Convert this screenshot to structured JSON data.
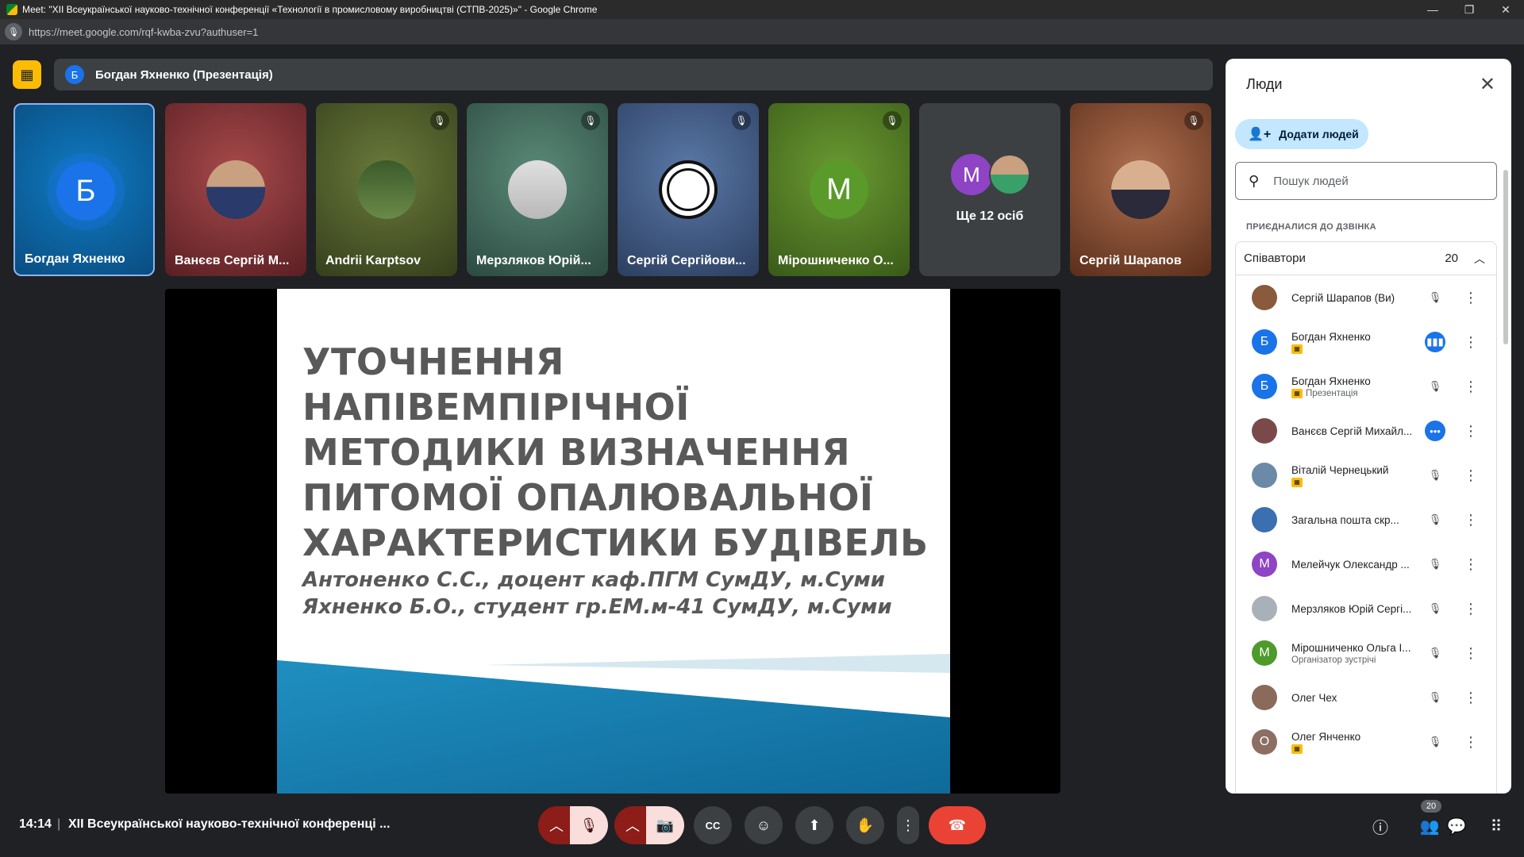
{
  "window": {
    "title": "Meet: \"XII Всеукраїнської науково-технічної конференції «Технології в промисловому виробництві (СТПВ-2025)»\" - Google Chrome",
    "url": "https://meet.google.com/rqf-kwba-zvu?authuser=1"
  },
  "presenter_bar": {
    "avatar_letter": "Б",
    "label": "Богдан Яхненко (Презентація)"
  },
  "tiles": [
    {
      "name": "Богдан Яхненко",
      "avatar": "Б",
      "bg": "#0b5fa0",
      "selected": true
    },
    {
      "name": "Ванєєв Сергій М...",
      "avatar": "",
      "bg": "#8a2f36"
    },
    {
      "name": "Andrii Karptsov",
      "avatar": "",
      "bg": "#4d5a2e"
    },
    {
      "name": "Мерзляков Юрій...",
      "avatar": "",
      "bg": "#3f6a5a"
    },
    {
      "name": "Сергій Сергійови...",
      "avatar": "",
      "bg": "#3c5a86"
    },
    {
      "name": "Мірошниченко О...",
      "avatar": "М",
      "bg": "#4e7a22"
    },
    {
      "name": "Ще 12 осіб",
      "avatar": "М",
      "bg": "#3c4043"
    },
    {
      "name": "Сергій Шарапов",
      "avatar": "",
      "bg": "#8a4a2c"
    }
  ],
  "slide": {
    "title_lines": [
      "УТОЧНЕННЯ НАПІВЕМПІРІЧНОЇ",
      "МЕТОДИКИ ВИЗНАЧЕННЯ",
      "ПИТОМОЇ ОПАЛЮВАЛЬНОЇ",
      "ХАРАКТЕРИСТИКИ БУДІВЕЛЬ"
    ],
    "author_lines": [
      "Антоненко С.С., доцент каф.ПГМ СумДУ, м.Суми",
      "Яхненко Б.О., студент гр.ЕМ.м-41 СумДУ, м.Суми"
    ]
  },
  "people_panel": {
    "title": "Люди",
    "add_label": "Додати людей",
    "search_placeholder": "Пошук людей",
    "section_label": "ПРИЄДНАЛИСЯ ДО ДЗВІНКА",
    "group_label": "Співавтори",
    "group_count": "20",
    "participants": [
      {
        "name": "Сергій Шарапов (Ви)",
        "sub": "",
        "badge": false,
        "avatar": "",
        "color": "#8a5a3c",
        "mic": "muted"
      },
      {
        "name": "Богдан Яхненко",
        "sub": "",
        "badge": true,
        "avatar": "Б",
        "color": "#1a73e8",
        "mic": "speaking"
      },
      {
        "name": "Богдан Яхненко",
        "sub": "Презентація",
        "badge": true,
        "avatar": "Б",
        "color": "#1a73e8",
        "mic": "muted"
      },
      {
        "name": "Ванєєв Сергій Михайл...",
        "sub": "",
        "badge": false,
        "avatar": "",
        "color": "#7a4a4a",
        "mic": "more"
      },
      {
        "name": "Віталій Чернецький",
        "sub": "",
        "badge": true,
        "avatar": "",
        "color": "#6b8aa8",
        "mic": "muted"
      },
      {
        "name": "Загальна пошта скр...",
        "sub": "",
        "badge": false,
        "avatar": "",
        "color": "#3a6fb0",
        "mic": "muted"
      },
      {
        "name": "Мелейчук Олександр ...",
        "sub": "",
        "badge": false,
        "avatar": "М",
        "color": "#8e44c4",
        "mic": "muted"
      },
      {
        "name": "Мерзляков Юрій Сергі...",
        "sub": "",
        "badge": false,
        "avatar": "",
        "color": "#a8b0b8",
        "mic": "muted"
      },
      {
        "name": "Мірошниченко Ольга І...",
        "sub": "Організатор зустрічі",
        "badge": false,
        "avatar": "М",
        "color": "#4e9a2a",
        "mic": "muted"
      },
      {
        "name": "Олег Чех",
        "sub": "",
        "badge": false,
        "avatar": "",
        "color": "#8a6a5a",
        "mic": "muted"
      },
      {
        "name": "Олег Янченко",
        "sub": "",
        "badge": true,
        "avatar": "О",
        "color": "#8d6e63",
        "mic": "muted"
      }
    ]
  },
  "bottom": {
    "time": "14:14",
    "separator": "|",
    "meeting_name": "XII Всеукраїнської науково-технічної конференці ...",
    "people_count": "20"
  },
  "icons": {
    "mic_off": "🎙",
    "cam_off": "📷",
    "captions": "CC",
    "emoji": "☺",
    "present": "⬆",
    "hand": "✋",
    "more": "⋮",
    "end_call": "☎",
    "info": "ⓘ",
    "people": "👥",
    "chat": "💬",
    "apps": "⠿"
  }
}
